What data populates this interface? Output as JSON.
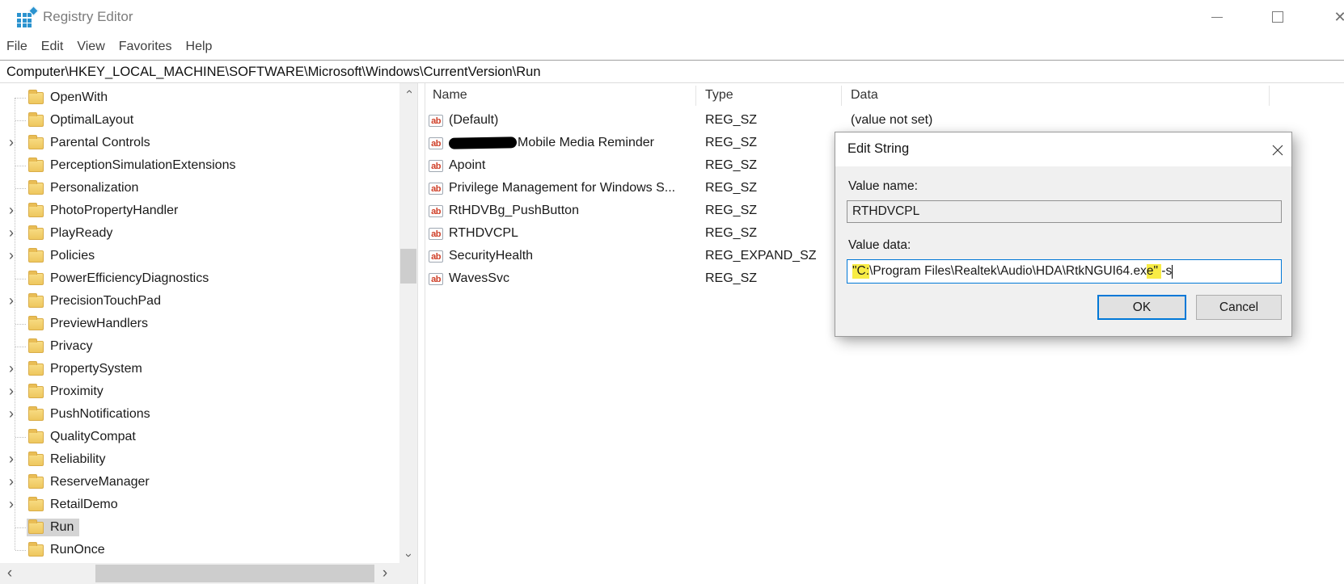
{
  "window": {
    "title": "Registry Editor",
    "controls": {
      "minimize": "minimize",
      "maximize": "maximize",
      "close": "close"
    }
  },
  "menu": {
    "items": [
      "File",
      "Edit",
      "View",
      "Favorites",
      "Help"
    ]
  },
  "address": {
    "path": "Computer\\HKEY_LOCAL_MACHINE\\SOFTWARE\\Microsoft\\Windows\\CurrentVersion\\Run"
  },
  "tree": {
    "items": [
      {
        "label": "OpenWith",
        "expandable": false,
        "selected": false
      },
      {
        "label": "OptimalLayout",
        "expandable": false,
        "selected": false
      },
      {
        "label": "Parental Controls",
        "expandable": true,
        "selected": false
      },
      {
        "label": "PerceptionSimulationExtensions",
        "expandable": false,
        "selected": false
      },
      {
        "label": "Personalization",
        "expandable": false,
        "selected": false
      },
      {
        "label": "PhotoPropertyHandler",
        "expandable": true,
        "selected": false
      },
      {
        "label": "PlayReady",
        "expandable": true,
        "selected": false
      },
      {
        "label": "Policies",
        "expandable": true,
        "selected": false
      },
      {
        "label": "PowerEfficiencyDiagnostics",
        "expandable": false,
        "selected": false
      },
      {
        "label": "PrecisionTouchPad",
        "expandable": true,
        "selected": false
      },
      {
        "label": "PreviewHandlers",
        "expandable": false,
        "selected": false
      },
      {
        "label": "Privacy",
        "expandable": false,
        "selected": false
      },
      {
        "label": "PropertySystem",
        "expandable": true,
        "selected": false
      },
      {
        "label": "Proximity",
        "expandable": true,
        "selected": false
      },
      {
        "label": "PushNotifications",
        "expandable": true,
        "selected": false
      },
      {
        "label": "QualityCompat",
        "expandable": false,
        "selected": false
      },
      {
        "label": "Reliability",
        "expandable": true,
        "selected": false
      },
      {
        "label": "ReserveManager",
        "expandable": true,
        "selected": false
      },
      {
        "label": "RetailDemo",
        "expandable": true,
        "selected": false
      },
      {
        "label": "Run",
        "expandable": false,
        "selected": true
      },
      {
        "label": "RunOnce",
        "expandable": false,
        "selected": false
      }
    ]
  },
  "list": {
    "columns": [
      "Name",
      "Type",
      "Data"
    ],
    "rows": [
      {
        "name": "(Default)",
        "type": "REG_SZ",
        "data": "(value not set)",
        "redacted": false
      },
      {
        "name": "Mobile Media Reminder",
        "type": "REG_SZ",
        "data": "",
        "redacted": true
      },
      {
        "name": "Apoint",
        "type": "REG_SZ",
        "data": "",
        "redacted": false
      },
      {
        "name": "Privilege Management for Windows S...",
        "type": "REG_SZ",
        "data": "",
        "redacted": false
      },
      {
        "name": "RtHDVBg_PushButton",
        "type": "REG_SZ",
        "data": "",
        "redacted": false
      },
      {
        "name": "RTHDVCPL",
        "type": "REG_SZ",
        "data": "",
        "redacted": false
      },
      {
        "name": "SecurityHealth",
        "type": "REG_EXPAND_SZ",
        "data": "",
        "redacted": false
      },
      {
        "name": "WavesSvc",
        "type": "REG_SZ",
        "data": "",
        "redacted": false
      }
    ]
  },
  "dialog": {
    "title": "Edit String",
    "value_name_label": "Value name:",
    "value_name": "RTHDVCPL",
    "value_data_label": "Value data:",
    "value_data_full": "\"C:\\Program Files\\Realtek\\Audio\\HDA\\RtkNGUI64.exe\" -s",
    "value_data_segments": [
      {
        "text": "\"C:",
        "highlight": true
      },
      {
        "text": "\\Program Files\\Realtek\\Audio\\HDA\\RtkNGUI64.ex",
        "highlight": false
      },
      {
        "text": "e\" ",
        "highlight": true
      },
      {
        "text": "-s",
        "highlight": false
      }
    ],
    "ok_label": "OK",
    "cancel_label": "Cancel"
  },
  "icons": {
    "string_value_glyph": "ab",
    "expander_glyph": "›",
    "scroll_left_glyph": "‹",
    "scroll_right_glyph": "›",
    "close_glyph": "✕"
  },
  "colors": {
    "accent_blue": "#0078d7",
    "highlight_yellow": "#f8ec45",
    "selection_gray": "#d4d4d4",
    "folder_yellow": "#f3d270",
    "value_icon_red": "#cf4029",
    "app_icon_blue": "#2b93cf",
    "dialog_bg": "#f0f0f0"
  }
}
